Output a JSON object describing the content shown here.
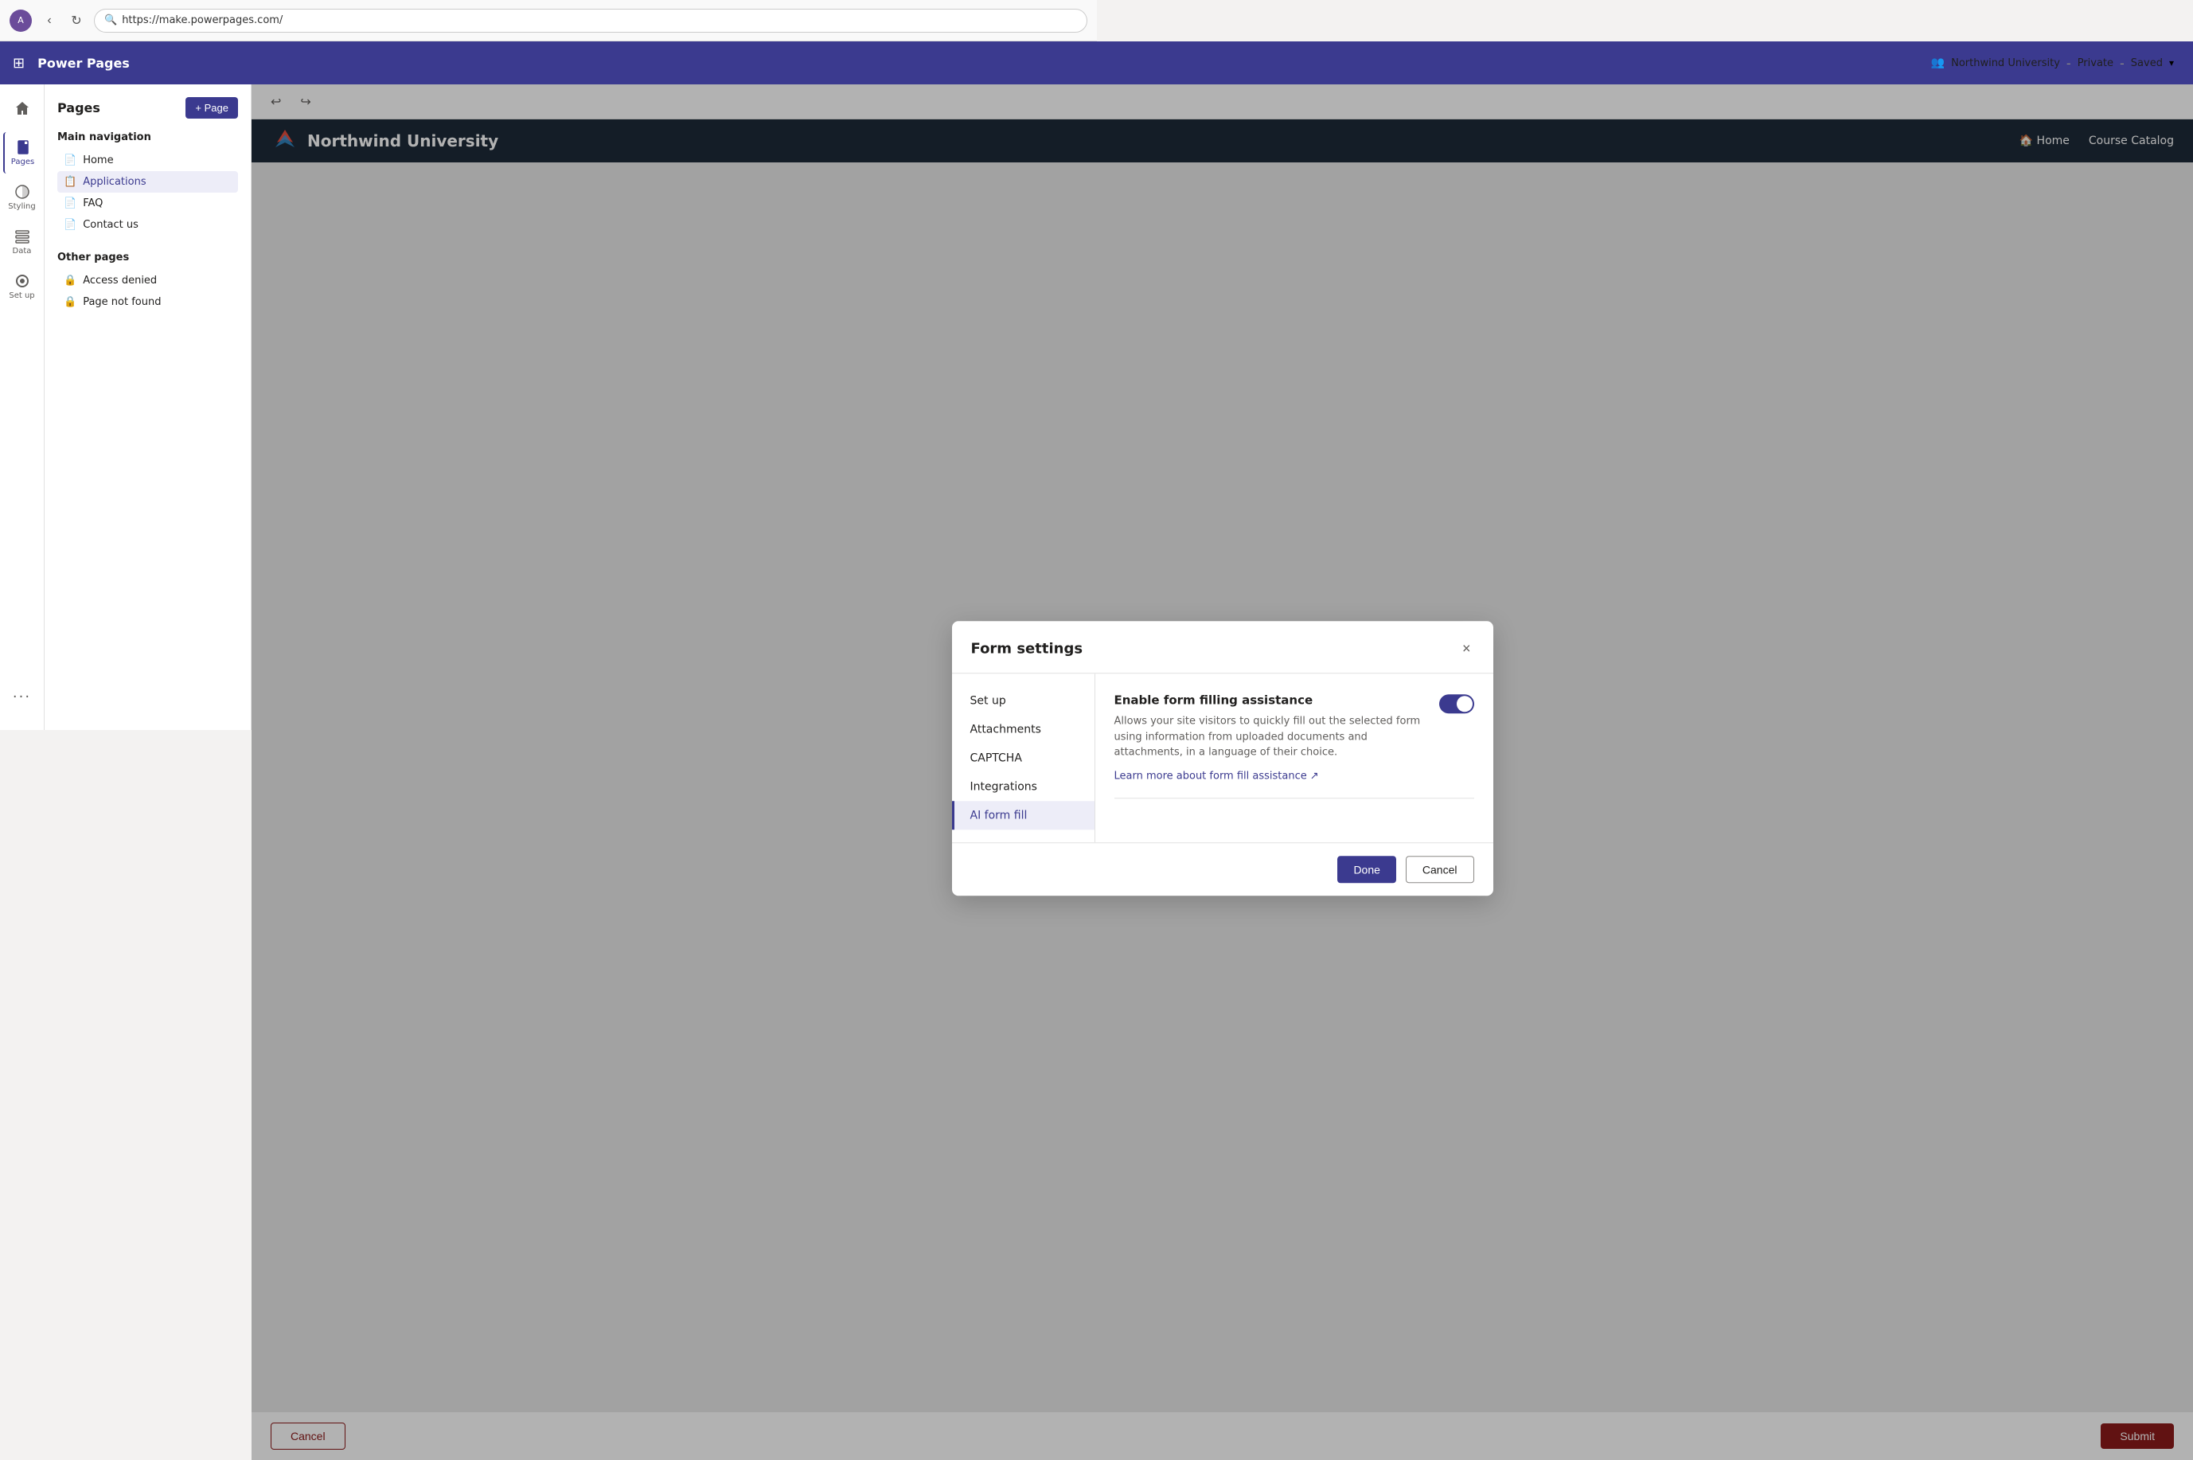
{
  "browser": {
    "url": "https://make.powerpages.com/"
  },
  "app": {
    "title": "Power Pages",
    "status": {
      "site": "Northwind University",
      "visibility": "Private",
      "save_state": "Saved"
    }
  },
  "icon_nav": [
    {
      "id": "home",
      "label": "",
      "icon": "home"
    },
    {
      "id": "pages",
      "label": "Pages",
      "icon": "pages",
      "active": true
    },
    {
      "id": "styling",
      "label": "Styling",
      "icon": "styling"
    },
    {
      "id": "data",
      "label": "Data",
      "icon": "data"
    },
    {
      "id": "setup",
      "label": "Set up",
      "icon": "setup"
    },
    {
      "id": "more",
      "label": "...",
      "icon": "more"
    }
  ],
  "pages_sidebar": {
    "title": "Pages",
    "add_button": "+ Page",
    "main_nav": {
      "title": "Main navigation",
      "items": [
        {
          "label": "Home",
          "icon": "page",
          "active": false
        },
        {
          "label": "Applications",
          "icon": "page-special",
          "active": true
        },
        {
          "label": "FAQ",
          "icon": "page",
          "active": false
        },
        {
          "label": "Contact us",
          "icon": "page",
          "active": false
        }
      ]
    },
    "other_pages": {
      "title": "Other pages",
      "items": [
        {
          "label": "Access denied",
          "icon": "lock"
        },
        {
          "label": "Page not found",
          "icon": "lock"
        }
      ]
    }
  },
  "toolbar": {
    "undo_label": "↩",
    "redo_label": "↪"
  },
  "site_preview": {
    "logo_text": "Northwind University",
    "nav_links": [
      "🏠 Home",
      "Course Catalog"
    ]
  },
  "form_settings_modal": {
    "title": "Form settings",
    "close_label": "×",
    "nav_items": [
      {
        "label": "Set up",
        "active": false
      },
      {
        "label": "Attachments",
        "active": false
      },
      {
        "label": "CAPTCHA",
        "active": false
      },
      {
        "label": "Integrations",
        "active": false
      },
      {
        "label": "AI form fill",
        "active": true
      }
    ],
    "ai_form_fill": {
      "toggle_title": "Enable form filling assistance",
      "toggle_enabled": true,
      "description": "Allows your site visitors to quickly fill out the selected form using information from uploaded documents and attachments, in a language of their choice.",
      "learn_more_label": "Learn more about form fill assistance",
      "learn_more_icon": "↗"
    },
    "footer": {
      "done_label": "Done",
      "cancel_label": "Cancel"
    }
  },
  "site_footer": {
    "cancel_label": "Cancel",
    "submit_label": "Submit"
  }
}
